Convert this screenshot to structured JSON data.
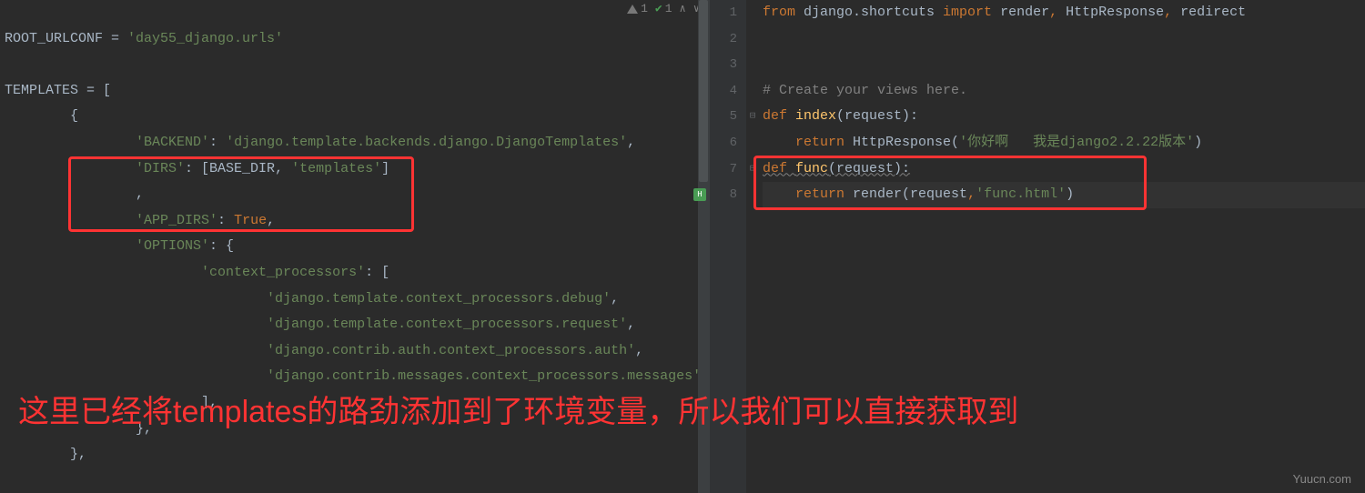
{
  "status": {
    "warnings": "1",
    "checks": "1"
  },
  "left_code": {
    "lines": [
      {
        "text": "",
        "indent": 0,
        "spans": []
      },
      {
        "text": "",
        "indent": 0,
        "spans": [
          {
            "t": "ROOT_URLCONF = ",
            "c": "identifier"
          },
          {
            "t": "'day55_django.urls'",
            "c": "string"
          }
        ]
      },
      {
        "text": "",
        "indent": 0,
        "spans": []
      },
      {
        "text": "",
        "indent": 0,
        "spans": [
          {
            "t": "TEMPLATES = [",
            "c": "identifier"
          }
        ]
      },
      {
        "text": "",
        "indent": 2,
        "spans": [
          {
            "t": "{",
            "c": "identifier"
          }
        ]
      },
      {
        "text": "",
        "indent": 4,
        "spans": [
          {
            "t": "'BACKEND'",
            "c": "string"
          },
          {
            "t": ": ",
            "c": "identifier"
          },
          {
            "t": "'django.template.backends.django.DjangoTemplates'",
            "c": "string"
          },
          {
            "t": ",",
            "c": "identifier"
          }
        ]
      },
      {
        "text": "",
        "indent": 4,
        "spans": [
          {
            "t": "'DIRS'",
            "c": "string"
          },
          {
            "t": ": [BASE_DIR, ",
            "c": "identifier"
          },
          {
            "t": "'templates'",
            "c": "string"
          },
          {
            "t": "]",
            "c": "identifier"
          }
        ]
      },
      {
        "text": "",
        "indent": 4,
        "spans": [
          {
            "t": ",",
            "c": "identifier"
          }
        ]
      },
      {
        "text": "",
        "indent": 4,
        "spans": [
          {
            "t": "'APP_DIRS'",
            "c": "string"
          },
          {
            "t": ": ",
            "c": "identifier"
          },
          {
            "t": "True",
            "c": "keyword"
          },
          {
            "t": ",",
            "c": "identifier"
          }
        ]
      },
      {
        "text": "",
        "indent": 4,
        "spans": [
          {
            "t": "'OPTIONS'",
            "c": "string"
          },
          {
            "t": ": {",
            "c": "identifier"
          }
        ]
      },
      {
        "text": "",
        "indent": 6,
        "spans": [
          {
            "t": "'context_processors'",
            "c": "string"
          },
          {
            "t": ": [",
            "c": "identifier"
          }
        ]
      },
      {
        "text": "",
        "indent": 8,
        "spans": [
          {
            "t": "'django.template.context_processors.debug'",
            "c": "string"
          },
          {
            "t": ",",
            "c": "identifier"
          }
        ]
      },
      {
        "text": "",
        "indent": 8,
        "spans": [
          {
            "t": "'django.template.context_processors.request'",
            "c": "string"
          },
          {
            "t": ",",
            "c": "identifier"
          }
        ]
      },
      {
        "text": "",
        "indent": 8,
        "spans": [
          {
            "t": "'django.contrib.auth.context_processors.auth'",
            "c": "string"
          },
          {
            "t": ",",
            "c": "identifier"
          }
        ]
      },
      {
        "text": "",
        "indent": 8,
        "spans": [
          {
            "t": "'django.contrib.messages.context_processors.messages'",
            "c": "string"
          },
          {
            "t": ",",
            "c": "identifier"
          }
        ]
      },
      {
        "text": "",
        "indent": 6,
        "spans": [
          {
            "t": "],",
            "c": "identifier"
          }
        ]
      },
      {
        "text": "",
        "indent": 4,
        "spans": [
          {
            "t": "},",
            "c": "identifier"
          }
        ]
      },
      {
        "text": "",
        "indent": 2,
        "spans": [
          {
            "t": "},",
            "c": "identifier"
          }
        ]
      }
    ]
  },
  "right_code": {
    "line_numbers": [
      "1",
      "2",
      "3",
      "4",
      "5",
      "6",
      "7",
      "8"
    ],
    "lines": [
      {
        "spans": [
          {
            "t": "from ",
            "c": "keyword"
          },
          {
            "t": "django.shortcuts ",
            "c": "identifier"
          },
          {
            "t": "import ",
            "c": "keyword"
          },
          {
            "t": "render",
            "c": "identifier"
          },
          {
            "t": ", ",
            "c": "keyword"
          },
          {
            "t": "HttpResponse",
            "c": "identifier"
          },
          {
            "t": ", ",
            "c": "keyword"
          },
          {
            "t": "redirect",
            "c": "identifier"
          }
        ]
      },
      {
        "spans": []
      },
      {
        "spans": []
      },
      {
        "spans": [
          {
            "t": "# Create your views here.",
            "c": "comment"
          }
        ]
      },
      {
        "spans": [
          {
            "t": "def ",
            "c": "keyword"
          },
          {
            "t": "index",
            "c": "func-name"
          },
          {
            "t": "(request):",
            "c": "identifier"
          }
        ]
      },
      {
        "spans": [
          {
            "t": "    ",
            "c": ""
          },
          {
            "t": "return ",
            "c": "keyword"
          },
          {
            "t": "HttpResponse(",
            "c": "identifier"
          },
          {
            "t": "'你好啊   我是django2.2.22版本'",
            "c": "string"
          },
          {
            "t": ")",
            "c": "identifier"
          }
        ]
      },
      {
        "spans": [
          {
            "t": "def ",
            "c": "keyword"
          },
          {
            "t": "func",
            "c": "func-name"
          },
          {
            "t": "(request):",
            "c": "identifier"
          }
        ],
        "wavy": true
      },
      {
        "spans": [
          {
            "t": "    ",
            "c": ""
          },
          {
            "t": "return ",
            "c": "keyword"
          },
          {
            "t": "render(request",
            "c": "identifier"
          },
          {
            "t": ",",
            "c": "keyword"
          },
          {
            "t": "'func.html'",
            "c": "string"
          },
          {
            "t": ")",
            "c": "identifier"
          }
        ],
        "current": true
      }
    ]
  },
  "annotation": "这里已经将templates的路劲添加到了环境变量，所以我们可以直接获取到",
  "watermark": "Yuucn.com"
}
